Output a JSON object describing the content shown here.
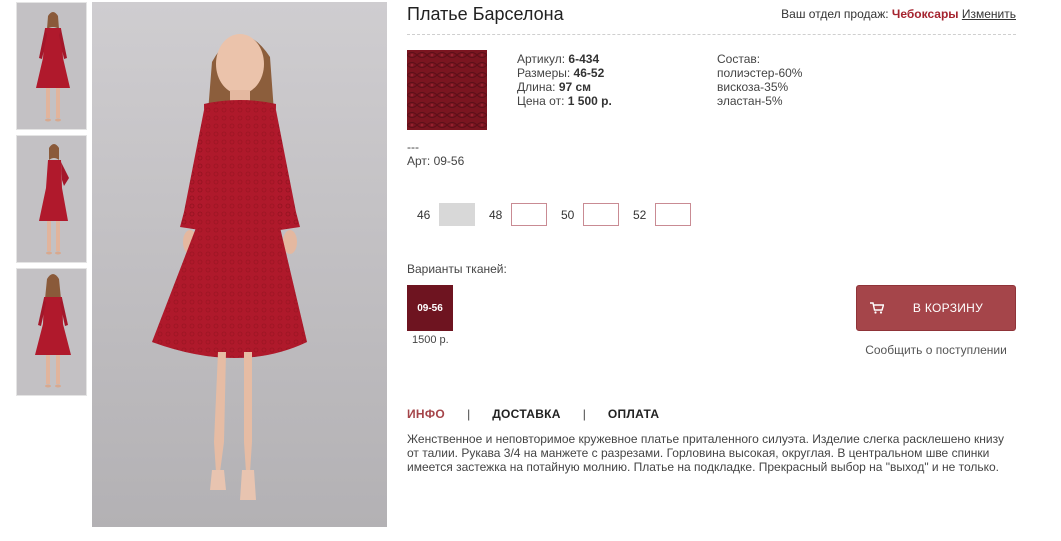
{
  "product": {
    "title": "Платье Барселона",
    "article_label": "Артикул:",
    "article_value": "6-434",
    "sizes_label": "Размеры:",
    "sizes_value": "46-52",
    "length_label": "Длина:",
    "length_value": "97 см",
    "price_label": "Цена от:",
    "price_value": "1 500 р.",
    "composition_label": "Состав:",
    "composition": [
      "полиэстер-60%",
      "вискоза-35%",
      "эластан-5%"
    ],
    "dashes": "---",
    "art_code": "Арт: 09-56",
    "description": "Женственное и неповторимое кружевное платье приталенного силуэта. Изделие слегка расклешено книзу от талии. Рукава 3/4 на манжете с разрезами. Горловина высокая, округлая. В центральном шве спинки имеется застежка на потайную молнию. Платье на подкладке. Прекрасный выбор на \"выход\" и не только."
  },
  "sales_department": {
    "label": "Ваш отдел продаж:",
    "city": "Чебоксары",
    "change_link": "Изменить"
  },
  "sizes": [
    {
      "label": "46",
      "available": false
    },
    {
      "label": "48",
      "available": true
    },
    {
      "label": "50",
      "available": true
    },
    {
      "label": "52",
      "available": true
    }
  ],
  "fabrics": {
    "label": "Варианты тканей:",
    "items": [
      {
        "code": "09-56",
        "price": "1500 р."
      }
    ]
  },
  "cart": {
    "button_label": "В КОРЗИНУ",
    "icon": "cart-icon",
    "notify_label": "Сообщить о поступлении"
  },
  "tabs": [
    {
      "label": "ИНФО",
      "active": true
    },
    {
      "label": "ДОСТАВКА",
      "active": false
    },
    {
      "label": "ОПЛАТА",
      "active": false
    }
  ],
  "tab_separator": "|",
  "colors": {
    "accent": "#a5454a",
    "city": "#a5242f",
    "dress": "#b0192c",
    "fabric": "#6e1420"
  }
}
